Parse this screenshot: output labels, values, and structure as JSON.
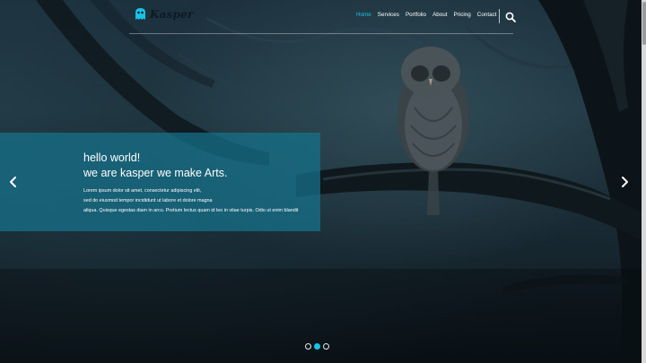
{
  "brand": {
    "name": "Kasper",
    "logo_icon": "ghost-icon",
    "accent_color": "#19c2e6"
  },
  "nav": {
    "items": [
      {
        "label": "Home",
        "active": true
      },
      {
        "label": "Services",
        "active": false
      },
      {
        "label": "Portfolio",
        "active": false
      },
      {
        "label": "About",
        "active": false
      },
      {
        "label": "Pricing",
        "active": false
      },
      {
        "label": "Contact",
        "active": false
      }
    ],
    "search_icon": "search-icon"
  },
  "slider": {
    "heading_line1": "hello world!",
    "heading_line2": "we are kasper we make Arts.",
    "body_line1": "Lorem ipsum dolor sit amet, consectetur adipiscing elit,",
    "body_line2": "sed do eiusmod tempor incididunt ut labore et dolore magna",
    "body_line3": "aliqua. Quisque egestas diam in arcu. Pretium lectus quam id leo in vitae turpis. Odio ut enim blandit",
    "prev_icon": "chevron-left-icon",
    "next_icon": "chevron-right-icon",
    "panel_color": "#16738c",
    "dots": [
      {
        "active": false
      },
      {
        "active": true
      },
      {
        "active": false
      }
    ]
  }
}
